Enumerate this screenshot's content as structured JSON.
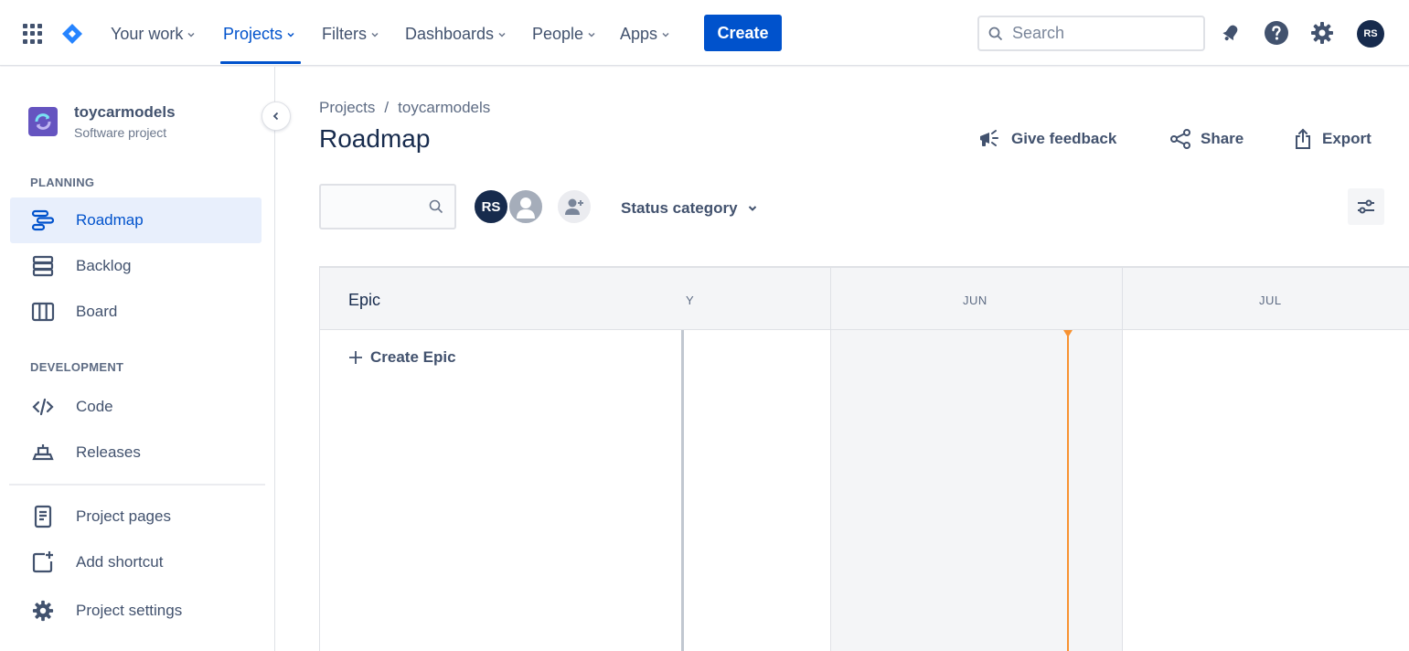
{
  "topnav": {
    "items": [
      {
        "label": "Your work"
      },
      {
        "label": "Projects"
      },
      {
        "label": "Filters"
      },
      {
        "label": "Dashboards"
      },
      {
        "label": "People"
      },
      {
        "label": "Apps"
      }
    ],
    "active_item": "Projects",
    "create_label": "Create",
    "search_placeholder": "Search",
    "user_initials": "RS",
    "icons": [
      "app-switcher-icon",
      "jira-logo-icon",
      "notification-icon",
      "help-icon",
      "settings-icon"
    ],
    "colors": {
      "accent": "#0052cc",
      "text": "#42526e"
    }
  },
  "sidebar": {
    "project_name": "toycarmodels",
    "project_type": "Software project",
    "sections": [
      {
        "heading": "PLANNING",
        "items": [
          {
            "label": "Roadmap",
            "icon": "roadmap-icon",
            "active": true
          },
          {
            "label": "Backlog",
            "icon": "backlog-icon"
          },
          {
            "label": "Board",
            "icon": "board-icon"
          }
        ]
      },
      {
        "heading": "DEVELOPMENT",
        "items": [
          {
            "label": "Code",
            "icon": "code-icon"
          },
          {
            "label": "Releases",
            "icon": "releases-icon"
          }
        ]
      }
    ],
    "footer_items": [
      {
        "label": "Project pages",
        "icon": "project-pages-icon"
      },
      {
        "label": "Add shortcut",
        "icon": "add-shortcut-icon"
      },
      {
        "label": "Project settings",
        "icon": "project-settings-icon"
      }
    ]
  },
  "main": {
    "breadcrumb": {
      "root": "Projects",
      "separator": "/",
      "current": "toycarmodels"
    },
    "title": "Roadmap",
    "actions": {
      "feedback": "Give feedback",
      "share": "Share",
      "export": "Export"
    },
    "toolbar": {
      "avatar_initials": "RS",
      "status_filter": "Status category"
    },
    "roadmap": {
      "epic_header": "Epic",
      "create_epic": "Create Epic",
      "months": [
        "Y",
        "JUN",
        "JUL"
      ],
      "today_color": "#f79232"
    }
  }
}
